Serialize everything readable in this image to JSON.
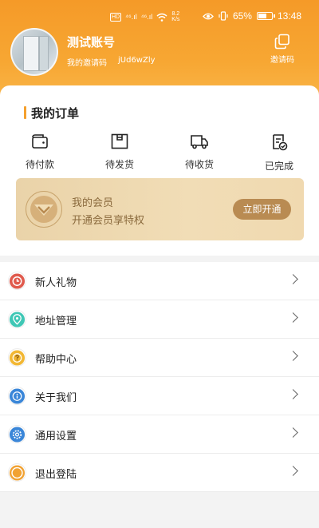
{
  "status_bar": {
    "signal_1": "⁴⁶.ıl",
    "signal_2": "⁴⁶.ıl",
    "speed_value": "8.2",
    "speed_unit": "K/s",
    "battery": "65%",
    "battery_level": 0.65,
    "time": "13:48"
  },
  "profile": {
    "name": "测试账号",
    "invite_label": "我的邀请码",
    "invite_code": "jUd6wZly",
    "invite_button": "邀请码"
  },
  "orders": {
    "title": "我的订单",
    "items": [
      {
        "label": "待付款",
        "icon": "wallet-icon"
      },
      {
        "label": "待发货",
        "icon": "box-icon"
      },
      {
        "label": "待收货",
        "icon": "truck-icon"
      },
      {
        "label": "已完成",
        "icon": "done-document-icon"
      }
    ]
  },
  "membership": {
    "title": "我的会员",
    "subtitle": "开通会员享特权",
    "button": "立即开通"
  },
  "menu": [
    {
      "label": "新人礼物",
      "icon": "clock-icon",
      "color": "#e05a4d"
    },
    {
      "label": "地址管理",
      "icon": "location-pin-icon",
      "color": "#3fc7b5"
    },
    {
      "label": "帮助中心",
      "icon": "question-icon",
      "color": "#f2b733"
    },
    {
      "label": "关于我们",
      "icon": "info-icon",
      "color": "#3a86d8"
    },
    {
      "label": "通用设置",
      "icon": "gear-icon",
      "color": "#3a86d8"
    },
    {
      "label": "退出登陆",
      "icon": "logout-icon",
      "color": "#f1a233"
    }
  ],
  "colors": {
    "header": "#f7a733",
    "accent": "#f5a02e",
    "vip_button": "#b98b52"
  }
}
